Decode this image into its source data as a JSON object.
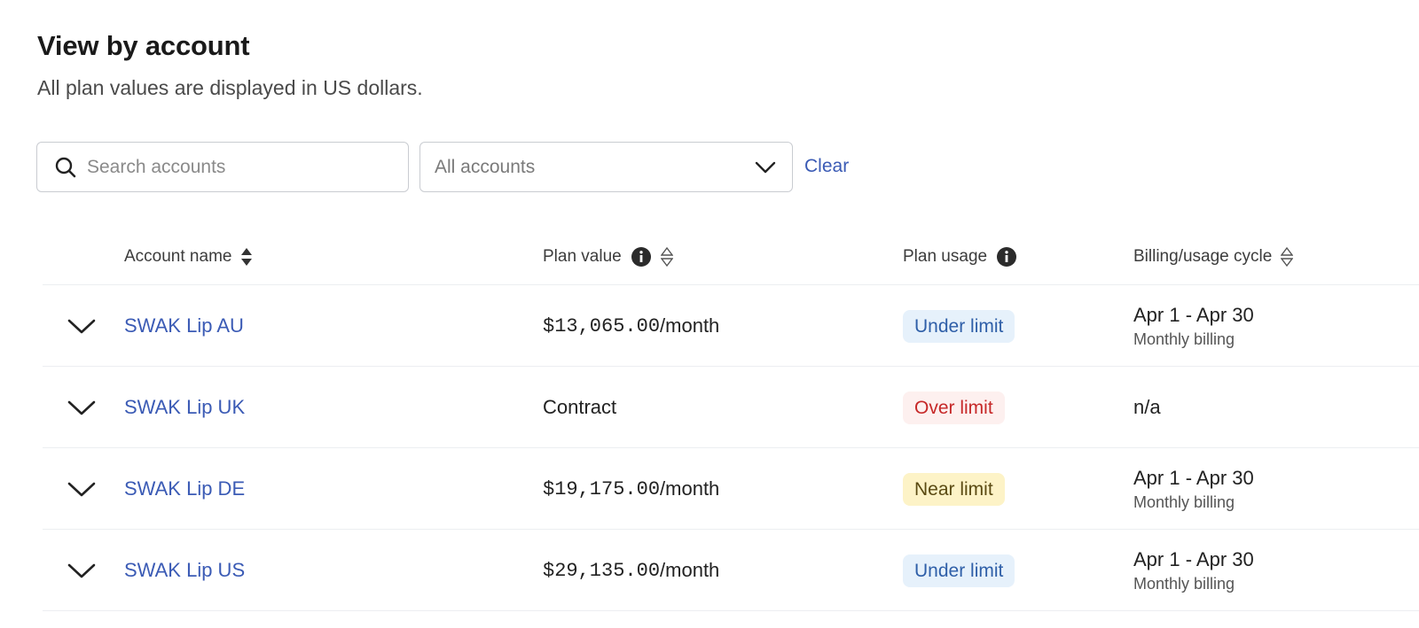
{
  "header": {
    "title": "View by account",
    "subtitle": "All plan values are displayed in US dollars."
  },
  "filters": {
    "search_placeholder": "Search accounts",
    "search_icon": "search-icon",
    "select_value": "All accounts",
    "select_icon": "chevron-down-icon",
    "clear_label": "Clear"
  },
  "table": {
    "columns": {
      "account_name": "Account name",
      "plan_value": "Plan value",
      "plan_usage": "Plan usage",
      "billing_cycle": "Billing/usage cycle"
    },
    "rows": [
      {
        "account": "SWAK Lip AU",
        "plan_amount": "$13,065.00",
        "plan_suffix": "/month",
        "usage": "Under limit",
        "usage_status": "under",
        "cycle": "Apr 1 - Apr 30",
        "cycle_sub": "Monthly billing"
      },
      {
        "account": "SWAK Lip UK",
        "plan_amount": "",
        "plan_suffix": "Contract",
        "usage": "Over limit",
        "usage_status": "over",
        "cycle": "n/a",
        "cycle_sub": ""
      },
      {
        "account": "SWAK Lip DE",
        "plan_amount": "$19,175.00",
        "plan_suffix": "/month",
        "usage": "Near limit",
        "usage_status": "near",
        "cycle": "Apr 1 - Apr 30",
        "cycle_sub": "Monthly billing"
      },
      {
        "account": "SWAK Lip US",
        "plan_amount": "$29,135.00",
        "plan_suffix": "/month",
        "usage": "Under limit",
        "usage_status": "under",
        "cycle": "Apr 1 - Apr 30",
        "cycle_sub": "Monthly billing"
      }
    ]
  },
  "colors": {
    "link": "#3b5bb5",
    "under_bg": "#e6f1fb",
    "over_text": "#c62828",
    "near_bg": "#fdf3c7"
  }
}
